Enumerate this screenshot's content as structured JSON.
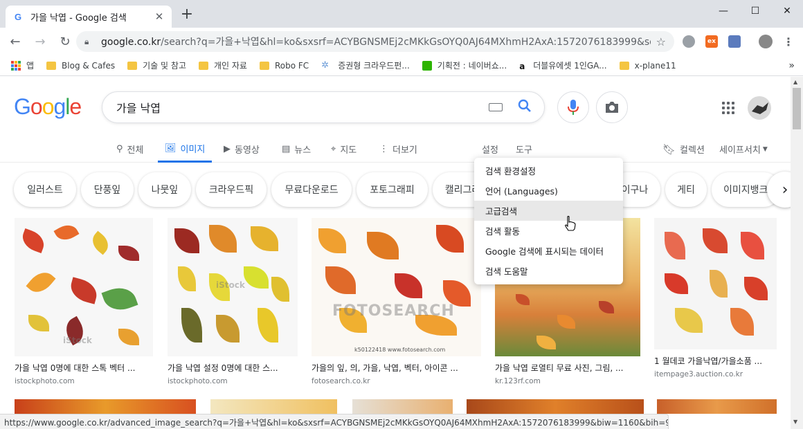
{
  "browser": {
    "tab_title": "가을 낙엽 - Google 검색",
    "favicon": "G",
    "new_tab": "+",
    "url_host": "google.co.kr",
    "url_rest": "/search?q=가을+낙엽&hl=ko&sxsrf=ACYBGNSMEj2cMKkGsOYQ0AJ64MXhmH2AxA:1572076183999&source=l...",
    "ext_ex_label": "ex"
  },
  "bookmarks": [
    {
      "label": "앱",
      "icon": "apps-icon"
    },
    {
      "label": "Blog & Cafes",
      "icon": "folder-icon"
    },
    {
      "label": "기술 및 참고",
      "icon": "folder-icon"
    },
    {
      "label": "개인 자료",
      "icon": "folder-icon"
    },
    {
      "label": "Robo FC",
      "icon": "folder-icon"
    },
    {
      "label": "증권형 크라우드펀...",
      "icon": "gear-site-icon"
    },
    {
      "label": "기획전 : 네이버쇼...",
      "icon": "naver-icon"
    },
    {
      "label": "더블유에셋 1인GA...",
      "icon": "amazon-icon"
    },
    {
      "label": "x-plane11",
      "icon": "folder-icon"
    }
  ],
  "bookmarks_more": "»",
  "google": {
    "logo_letters": [
      "G",
      "o",
      "o",
      "g",
      "l",
      "e"
    ],
    "logo_colors": [
      "#4285f4",
      "#ea4335",
      "#fbbc05",
      "#4285f4",
      "#34a853",
      "#ea4335"
    ],
    "query": "가을 낙엽"
  },
  "tabs": [
    {
      "label": "전체",
      "icon": "search-icon"
    },
    {
      "label": "이미지",
      "icon": "image-icon"
    },
    {
      "label": "동영상",
      "icon": "video-icon"
    },
    {
      "label": "뉴스",
      "icon": "news-icon"
    },
    {
      "label": "지도",
      "icon": "map-icon"
    },
    {
      "label": "더보기",
      "icon": "more-vert-icon"
    }
  ],
  "tools": {
    "settings": "설정",
    "tools": "도구",
    "collections": "컬렉션",
    "safesearch": "세이프서치"
  },
  "chips": [
    "일러스트",
    "단풍잎",
    "나뭇잎",
    "크라우드픽",
    "무료다운로드",
    "포토그래피",
    "캘리그라피",
    "이구나",
    "게티",
    "이미지뱅크"
  ],
  "settings_menu": [
    "검색 환경설정",
    "언어 (Languages)",
    "고급검색",
    "검색 활동",
    "Google 검색에 표시되는 데이터",
    "검색 도움말"
  ],
  "results": [
    {
      "caption": "가을 낙엽 0명에 대한 스톡 벡터 ...",
      "source": "istockphoto.com",
      "watermark": "iStock"
    },
    {
      "caption": "가을 낙엽 설정 0명에 대한 스...",
      "source": "istockphoto.com",
      "watermark": "iStock"
    },
    {
      "caption": "가을의 잎, 의, 가을, 낙엽, 벡터, 아이콘 ...",
      "source": "fotosearch.co.kr",
      "watermark": "FOTOSEARCH",
      "stock_id": "k50122418  www.fotosearch.com"
    },
    {
      "caption": "가을 낙엽 로열티 무료 사진, 그림, ...",
      "source": "kr.123rf.com",
      "watermark": ""
    },
    {
      "caption": "1 월데코 가을낙엽/가을소품 ...",
      "source": "itempage3.auction.co.kr",
      "watermark": ""
    }
  ],
  "status_url": "https://www.google.co.kr/advanced_image_search?q=가을+낙엽&hl=ko&sxsrf=ACYBGNSMEj2cMKkGsOYQ0AJ64MXhmH2AxA:1572076183999&biw=1160&bih=927&tbm=isch"
}
